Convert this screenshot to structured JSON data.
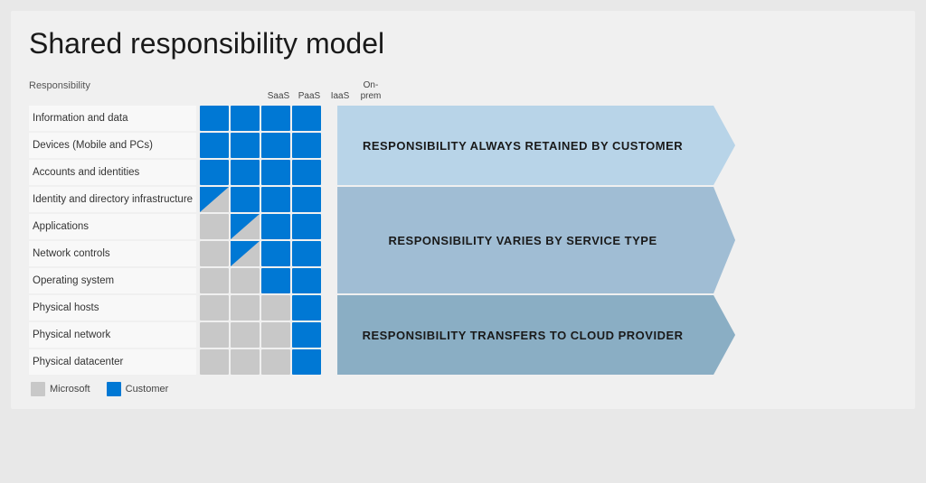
{
  "title": "Shared responsibility model",
  "columns": {
    "responsibility_label": "Responsibility",
    "headers": [
      "SaaS",
      "PaaS",
      "IaaS",
      "On-\nprem"
    ]
  },
  "rows": [
    {
      "label": "Information and data",
      "cells": [
        "blue",
        "blue",
        "blue",
        "blue"
      ]
    },
    {
      "label": "Devices (Mobile and PCs)",
      "cells": [
        "blue",
        "blue",
        "blue",
        "blue"
      ]
    },
    {
      "label": "Accounts and identities",
      "cells": [
        "blue",
        "blue",
        "blue",
        "blue"
      ]
    },
    {
      "label": "Identity and directory infrastructure",
      "cells": [
        "half",
        "blue",
        "blue",
        "blue"
      ]
    },
    {
      "label": "Applications",
      "cells": [
        "gray",
        "half",
        "blue",
        "blue"
      ]
    },
    {
      "label": "Network controls",
      "cells": [
        "gray",
        "half",
        "blue",
        "blue"
      ]
    },
    {
      "label": "Operating system",
      "cells": [
        "gray",
        "gray",
        "blue",
        "blue"
      ]
    },
    {
      "label": "Physical hosts",
      "cells": [
        "gray",
        "gray",
        "gray",
        "blue"
      ]
    },
    {
      "label": "Physical network",
      "cells": [
        "gray",
        "gray",
        "gray",
        "blue"
      ]
    },
    {
      "label": "Physical datacenter",
      "cells": [
        "gray",
        "gray",
        "gray",
        "blue"
      ]
    }
  ],
  "arrows": [
    {
      "label": "RESPONSIBILITY ALWAYS RETAINED BY CUSTOMER",
      "row_start": 0,
      "row_end": 2,
      "style": "top"
    },
    {
      "label": "RESPONSIBILITY VARIES BY SERVICE TYPE",
      "row_start": 3,
      "row_end": 6,
      "style": "mid"
    },
    {
      "label": "RESPONSIBILITY TRANSFERS TO CLOUD PROVIDER",
      "row_start": 7,
      "row_end": 9,
      "style": "bot"
    }
  ],
  "legend": {
    "microsoft_label": "Microsoft",
    "customer_label": "Customer"
  }
}
